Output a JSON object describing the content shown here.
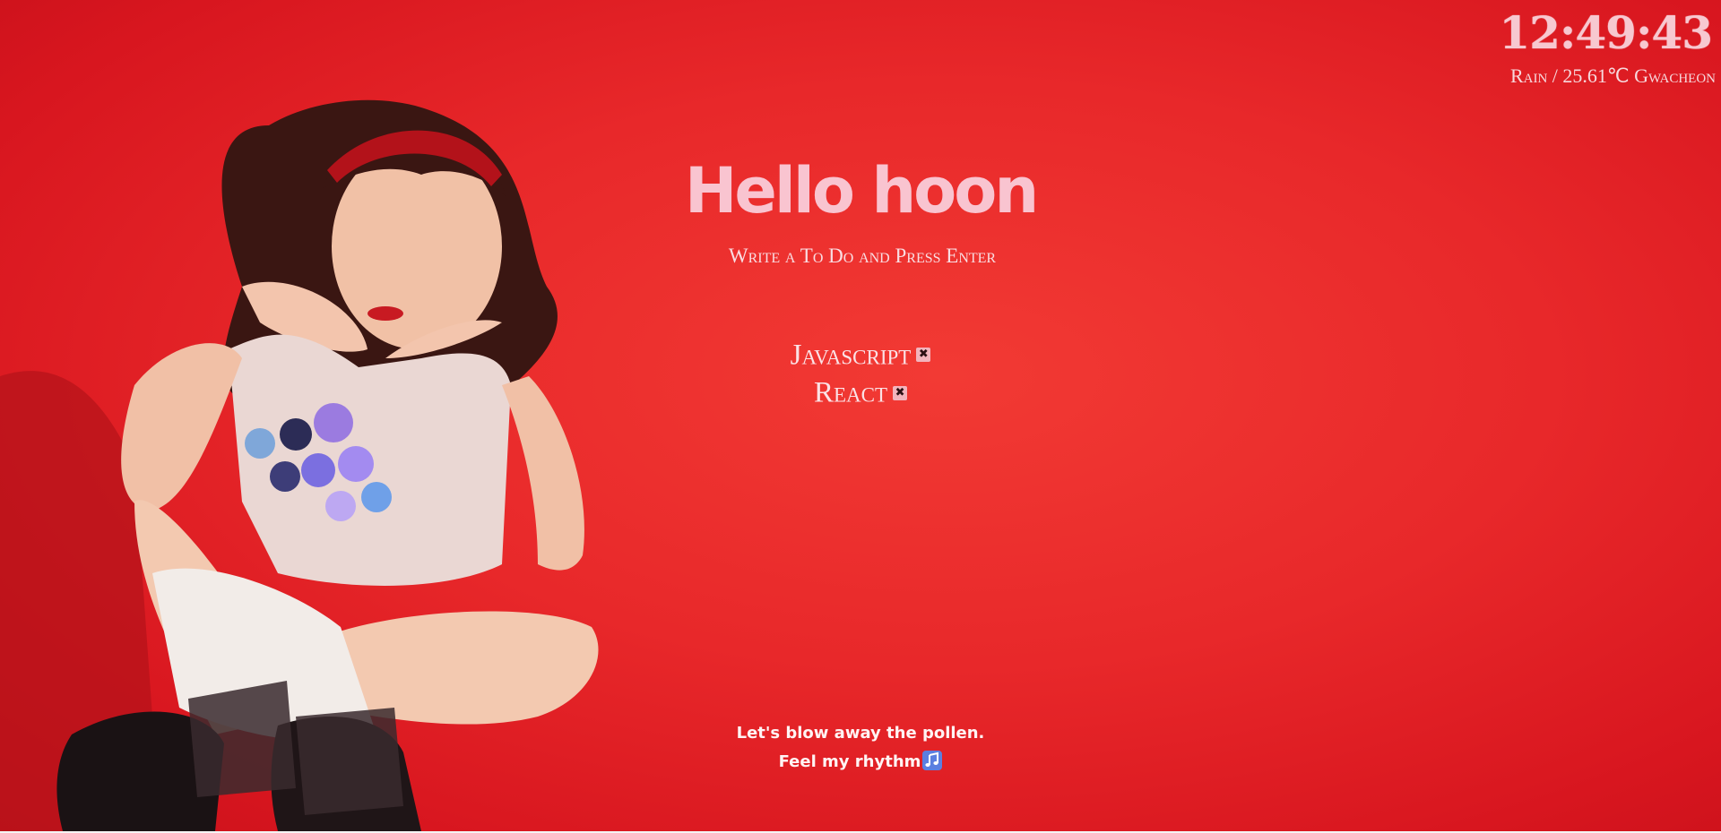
{
  "clock": {
    "time": "12:49:43"
  },
  "weather": {
    "text": "Rain / 25.61℃ Gwacheon"
  },
  "greeting": {
    "text": "Hello hoon"
  },
  "todo": {
    "placeholder": "Write a To Do and Press Enter",
    "items": [
      {
        "text": "Javascript",
        "delete_label": "✖"
      },
      {
        "text": "React",
        "delete_label": "✖"
      }
    ]
  },
  "lyric": {
    "line1": "Let's blow away the pollen.",
    "line2": "Feel my rhythm",
    "icon": "music-note-icon"
  },
  "colors": {
    "background": "#e8282a",
    "accent_pink": "#f9c4d0"
  },
  "background_image": {
    "icon": "person-photo-icon"
  }
}
